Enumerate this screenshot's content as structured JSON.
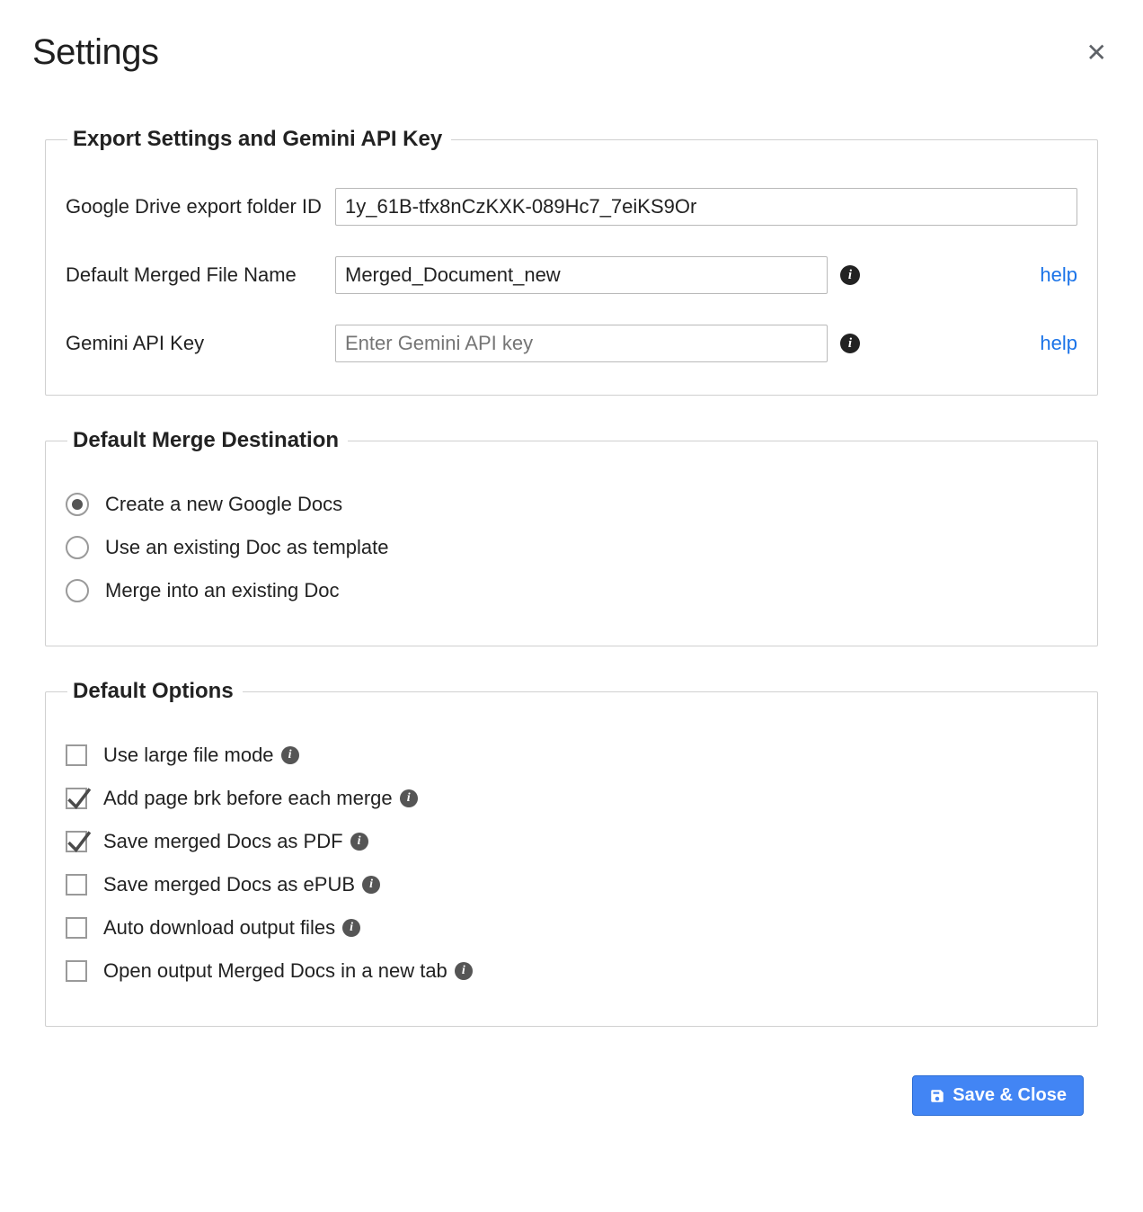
{
  "dialog": {
    "title": "Settings"
  },
  "export_settings": {
    "legend": "Export Settings and Gemini API Key",
    "folder_id_label": "Google Drive export folder ID",
    "folder_id_value": "1y_61B-tfx8nCzKXK-089Hc7_7eiKS9Or",
    "default_filename_label": "Default Merged File Name",
    "default_filename_value": "Merged_Document_new",
    "gemini_key_label": "Gemini API Key",
    "gemini_key_value": "",
    "gemini_key_placeholder": "Enter Gemini API key",
    "help_label": "help"
  },
  "merge_destination": {
    "legend": "Default Merge Destination",
    "options": [
      {
        "label": "Create a new Google Docs",
        "checked": true
      },
      {
        "label": "Use an existing Doc as template",
        "checked": false
      },
      {
        "label": "Merge into an existing Doc",
        "checked": false
      }
    ]
  },
  "default_options": {
    "legend": "Default Options",
    "items": [
      {
        "label": "Use large file mode",
        "checked": false
      },
      {
        "label": "Add page brk before each merge",
        "checked": true
      },
      {
        "label": "Save merged Docs as PDF",
        "checked": true
      },
      {
        "label": "Save merged Docs as ePUB",
        "checked": false
      },
      {
        "label": "Auto download output files",
        "checked": false
      },
      {
        "label": "Open output Merged Docs in a new tab",
        "checked": false
      }
    ]
  },
  "footer": {
    "save_label": "Save & Close"
  }
}
